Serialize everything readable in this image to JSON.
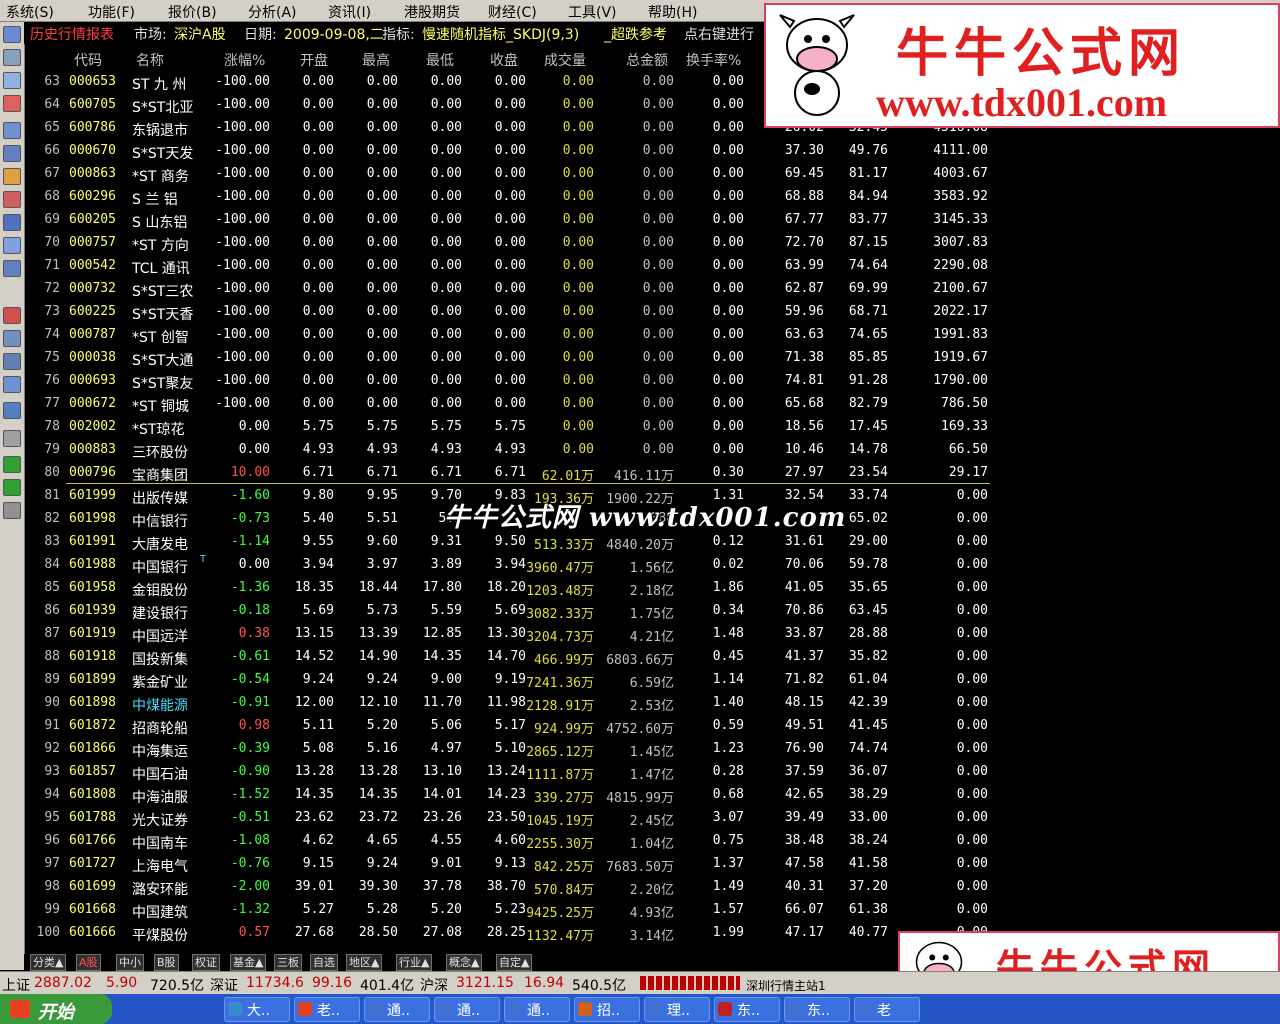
{
  "menu": [
    "系统(S)",
    "功能(F)",
    "报价(B)",
    "分析(A)",
    "资讯(I)",
    "港股期货",
    "财经(C)",
    "工具(V)",
    "帮助(H)"
  ],
  "infobar": {
    "title": "历史行情报表",
    "market_label": "市场:",
    "market": "深沪A股",
    "date_label": "日期:",
    "date": "2009-09-08,二",
    "indicator_label": "指标:",
    "indicator": "慢速随机指标_SKDJ(9,3)",
    "extra1": "_超跌参考",
    "extra2": "点右键进行"
  },
  "columns": [
    "代码",
    "名称",
    "涨幅%",
    "开盘",
    "最高",
    "最低",
    "收盘",
    "成交量",
    "总金额",
    "换手率%"
  ],
  "rows": [
    {
      "no": "63",
      "code": "000653",
      "name": "ST 九 州",
      "chg": "-100.00",
      "open": "0.00",
      "high": "0.00",
      "low": "0.00",
      "close": "0.00",
      "vol": "0.00",
      "amt": "0.00",
      "turn": "0.00",
      "k": "",
      "d": "",
      "x": ""
    },
    {
      "no": "64",
      "code": "600705",
      "name": "S*ST北亚",
      "chg": "-100.00",
      "open": "0.00",
      "high": "0.00",
      "low": "0.00",
      "close": "0.00",
      "vol": "0.00",
      "amt": "0.00",
      "turn": "0.00",
      "k": "",
      "d": "",
      "x": ""
    },
    {
      "no": "65",
      "code": "600786",
      "name": "东锅退市",
      "chg": "-100.00",
      "open": "0.00",
      "high": "0.00",
      "low": "0.00",
      "close": "0.00",
      "vol": "0.00",
      "amt": "0.00",
      "turn": "0.00",
      "k": "",
      "d": "",
      "x": ""
    },
    {
      "no": "66",
      "code": "000670",
      "name": "S*ST天发",
      "chg": "-100.00",
      "open": "0.00",
      "high": "0.00",
      "low": "0.00",
      "close": "0.00",
      "vol": "0.00",
      "amt": "0.00",
      "turn": "0.00",
      "k": "37.30",
      "d": "49.76",
      "x": "4111.00"
    },
    {
      "no": "67",
      "code": "000863",
      "name": "*ST 商务",
      "chg": "-100.00",
      "open": "0.00",
      "high": "0.00",
      "low": "0.00",
      "close": "0.00",
      "vol": "0.00",
      "amt": "0.00",
      "turn": "0.00",
      "k": "69.45",
      "d": "81.17",
      "x": "4003.67"
    },
    {
      "no": "68",
      "code": "600296",
      "name": "S 兰 铝",
      "chg": "-100.00",
      "open": "0.00",
      "high": "0.00",
      "low": "0.00",
      "close": "0.00",
      "vol": "0.00",
      "amt": "0.00",
      "turn": "0.00",
      "k": "68.88",
      "d": "84.94",
      "x": "3583.92"
    },
    {
      "no": "69",
      "code": "600205",
      "name": "S 山东铝",
      "chg": "-100.00",
      "open": "0.00",
      "high": "0.00",
      "low": "0.00",
      "close": "0.00",
      "vol": "0.00",
      "amt": "0.00",
      "turn": "0.00",
      "k": "67.77",
      "d": "83.77",
      "x": "3145.33"
    },
    {
      "no": "70",
      "code": "000757",
      "name": "*ST 方向",
      "chg": "-100.00",
      "open": "0.00",
      "high": "0.00",
      "low": "0.00",
      "close": "0.00",
      "vol": "0.00",
      "amt": "0.00",
      "turn": "0.00",
      "k": "72.70",
      "d": "87.15",
      "x": "3007.83"
    },
    {
      "no": "71",
      "code": "000542",
      "name": "TCL 通讯",
      "chg": "-100.00",
      "open": "0.00",
      "high": "0.00",
      "low": "0.00",
      "close": "0.00",
      "vol": "0.00",
      "amt": "0.00",
      "turn": "0.00",
      "k": "63.99",
      "d": "74.64",
      "x": "2290.08"
    },
    {
      "no": "72",
      "code": "000732",
      "name": "S*ST三农",
      "chg": "-100.00",
      "open": "0.00",
      "high": "0.00",
      "low": "0.00",
      "close": "0.00",
      "vol": "0.00",
      "amt": "0.00",
      "turn": "0.00",
      "k": "62.87",
      "d": "69.99",
      "x": "2100.67"
    },
    {
      "no": "73",
      "code": "600225",
      "name": "S*ST天香",
      "chg": "-100.00",
      "open": "0.00",
      "high": "0.00",
      "low": "0.00",
      "close": "0.00",
      "vol": "0.00",
      "amt": "0.00",
      "turn": "0.00",
      "k": "59.96",
      "d": "68.71",
      "x": "2022.17"
    },
    {
      "no": "74",
      "code": "000787",
      "name": "*ST 创智",
      "chg": "-100.00",
      "open": "0.00",
      "high": "0.00",
      "low": "0.00",
      "close": "0.00",
      "vol": "0.00",
      "amt": "0.00",
      "turn": "0.00",
      "k": "63.63",
      "d": "74.65",
      "x": "1991.83"
    },
    {
      "no": "75",
      "code": "000038",
      "name": "S*ST大通",
      "chg": "-100.00",
      "open": "0.00",
      "high": "0.00",
      "low": "0.00",
      "close": "0.00",
      "vol": "0.00",
      "amt": "0.00",
      "turn": "0.00",
      "k": "71.38",
      "d": "85.85",
      "x": "1919.67"
    },
    {
      "no": "76",
      "code": "000693",
      "name": "S*ST聚友",
      "chg": "-100.00",
      "open": "0.00",
      "high": "0.00",
      "low": "0.00",
      "close": "0.00",
      "vol": "0.00",
      "amt": "0.00",
      "turn": "0.00",
      "k": "74.81",
      "d": "91.28",
      "x": "1790.00"
    },
    {
      "no": "77",
      "code": "000672",
      "name": "*ST 铜城",
      "chg": "-100.00",
      "open": "0.00",
      "high": "0.00",
      "low": "0.00",
      "close": "0.00",
      "vol": "0.00",
      "amt": "0.00",
      "turn": "0.00",
      "k": "65.68",
      "d": "82.79",
      "x": "786.50"
    },
    {
      "no": "78",
      "code": "002002",
      "name": "*ST琼花",
      "chg": "0.00",
      "open": "5.75",
      "high": "5.75",
      "low": "5.75",
      "close": "5.75",
      "vol": "0.00",
      "amt": "0.00",
      "turn": "0.00",
      "k": "18.56",
      "d": "17.45",
      "x": "169.33"
    },
    {
      "no": "79",
      "code": "000883",
      "name": "三环股份",
      "chg": "0.00",
      "open": "4.93",
      "high": "4.93",
      "low": "4.93",
      "close": "4.93",
      "vol": "0.00",
      "amt": "0.00",
      "turn": "0.00",
      "k": "10.46",
      "d": "14.78",
      "x": "66.50"
    },
    {
      "no": "80",
      "code": "000796",
      "name": "宝商集团",
      "chg": "10.00",
      "open": "6.71",
      "high": "6.71",
      "low": "6.71",
      "close": "6.71",
      "vol": "62.01万",
      "amt": "416.11万",
      "turn": "0.30",
      "k": "27.97",
      "d": "23.54",
      "x": "29.17"
    },
    {
      "no": "81",
      "code": "601999",
      "name": "出版传媒",
      "chg": "-1.60",
      "open": "9.80",
      "high": "9.95",
      "low": "9.70",
      "close": "9.83",
      "vol": "193.36万",
      "amt": "1900.22万",
      "turn": "1.31",
      "k": "32.54",
      "d": "33.74",
      "x": "0.00"
    },
    {
      "no": "82",
      "code": "601998",
      "name": "中信银行",
      "chg": "-0.73",
      "open": "5.40",
      "high": "5.51",
      "low": "5.3",
      "close": "",
      "vol": "",
      "amt": "888",
      "turn": "",
      "k": "",
      "d": "65.02",
      "x": "0.00"
    },
    {
      "no": "83",
      "code": "601991",
      "name": "大唐发电",
      "chg": "-1.14",
      "open": "9.55",
      "high": "9.60",
      "low": "9.31",
      "close": "9.50",
      "vol": "513.33万",
      "amt": "4840.20万",
      "turn": "0.12",
      "k": "31.61",
      "d": "29.00",
      "x": "0.00"
    },
    {
      "no": "84",
      "code": "601988",
      "name": "中国银行",
      "chg": "0.00",
      "open": "3.94",
      "high": "3.97",
      "low": "3.89",
      "close": "3.94",
      "vol": "3960.47万",
      "amt": "1.56亿",
      "turn": "0.02",
      "k": "70.06",
      "d": "59.78",
      "x": "0.00"
    },
    {
      "no": "85",
      "code": "601958",
      "name": "金钼股份",
      "chg": "-1.36",
      "open": "18.35",
      "high": "18.44",
      "low": "17.80",
      "close": "18.20",
      "vol": "1203.48万",
      "amt": "2.18亿",
      "turn": "1.86",
      "k": "41.05",
      "d": "35.65",
      "x": "0.00"
    },
    {
      "no": "86",
      "code": "601939",
      "name": "建设银行",
      "chg": "-0.18",
      "open": "5.69",
      "high": "5.73",
      "low": "5.59",
      "close": "5.69",
      "vol": "3082.33万",
      "amt": "1.75亿",
      "turn": "0.34",
      "k": "70.86",
      "d": "63.45",
      "x": "0.00"
    },
    {
      "no": "87",
      "code": "601919",
      "name": "中国远洋",
      "chg": "0.38",
      "open": "13.15",
      "high": "13.39",
      "low": "12.85",
      "close": "13.30",
      "vol": "3204.73万",
      "amt": "4.21亿",
      "turn": "1.48",
      "k": "33.87",
      "d": "28.88",
      "x": "0.00"
    },
    {
      "no": "88",
      "code": "601918",
      "name": "国投新集",
      "chg": "-0.61",
      "open": "14.52",
      "high": "14.90",
      "low": "14.35",
      "close": "14.70",
      "vol": "466.99万",
      "amt": "6803.66万",
      "turn": "0.45",
      "k": "41.37",
      "d": "35.82",
      "x": "0.00"
    },
    {
      "no": "89",
      "code": "601899",
      "name": "紫金矿业",
      "chg": "-0.54",
      "open": "9.24",
      "high": "9.24",
      "low": "9.00",
      "close": "9.19",
      "vol": "7241.36万",
      "amt": "6.59亿",
      "turn": "1.14",
      "k": "71.82",
      "d": "61.04",
      "x": "0.00"
    },
    {
      "no": "90",
      "code": "601898",
      "name": "中煤能源",
      "chg": "-0.91",
      "open": "12.00",
      "high": "12.10",
      "low": "11.70",
      "close": "11.98",
      "vol": "2128.91万",
      "amt": "2.53亿",
      "turn": "1.40",
      "k": "48.15",
      "d": "42.39",
      "x": "0.00"
    },
    {
      "no": "91",
      "code": "601872",
      "name": "招商轮船",
      "chg": "0.98",
      "open": "5.11",
      "high": "5.20",
      "low": "5.06",
      "close": "5.17",
      "vol": "924.99万",
      "amt": "4752.60万",
      "turn": "0.59",
      "k": "49.51",
      "d": "41.45",
      "x": "0.00"
    },
    {
      "no": "92",
      "code": "601866",
      "name": "中海集运",
      "chg": "-0.39",
      "open": "5.08",
      "high": "5.16",
      "low": "4.97",
      "close": "5.10",
      "vol": "2865.12万",
      "amt": "1.45亿",
      "turn": "1.23",
      "k": "76.90",
      "d": "74.74",
      "x": "0.00"
    },
    {
      "no": "93",
      "code": "601857",
      "name": "中国石油",
      "chg": "-0.90",
      "open": "13.28",
      "high": "13.28",
      "low": "13.10",
      "close": "13.24",
      "vol": "1111.87万",
      "amt": "1.47亿",
      "turn": "0.28",
      "k": "37.59",
      "d": "36.07",
      "x": "0.00"
    },
    {
      "no": "94",
      "code": "601808",
      "name": "中海油服",
      "chg": "-1.52",
      "open": "14.35",
      "high": "14.35",
      "low": "14.01",
      "close": "14.23",
      "vol": "339.27万",
      "amt": "4815.99万",
      "turn": "0.68",
      "k": "42.65",
      "d": "38.29",
      "x": "0.00"
    },
    {
      "no": "95",
      "code": "601788",
      "name": "光大证券",
      "chg": "-0.51",
      "open": "23.62",
      "high": "23.72",
      "low": "23.26",
      "close": "23.50",
      "vol": "1045.19万",
      "amt": "2.45亿",
      "turn": "3.07",
      "k": "39.49",
      "d": "33.00",
      "x": "0.00"
    },
    {
      "no": "96",
      "code": "601766",
      "name": "中国南车",
      "chg": "-1.08",
      "open": "4.62",
      "high": "4.65",
      "low": "4.55",
      "close": "4.60",
      "vol": "2255.30万",
      "amt": "1.04亿",
      "turn": "0.75",
      "k": "38.48",
      "d": "38.24",
      "x": "0.00"
    },
    {
      "no": "97",
      "code": "601727",
      "name": "上海电气",
      "chg": "-0.76",
      "open": "9.15",
      "high": "9.24",
      "low": "9.01",
      "close": "9.13",
      "vol": "842.25万",
      "amt": "7683.50万",
      "turn": "1.37",
      "k": "47.58",
      "d": "41.58",
      "x": "0.00"
    },
    {
      "no": "98",
      "code": "601699",
      "name": "潞安环能",
      "chg": "-2.00",
      "open": "39.01",
      "high": "39.30",
      "low": "37.78",
      "close": "38.70",
      "vol": "570.84万",
      "amt": "2.20亿",
      "turn": "1.49",
      "k": "40.31",
      "d": "37.20",
      "x": "0.00"
    },
    {
      "no": "99",
      "code": "601668",
      "name": "中国建筑",
      "chg": "-1.32",
      "open": "5.27",
      "high": "5.28",
      "low": "5.20",
      "close": "5.23",
      "vol": "9425.25万",
      "amt": "4.93亿",
      "turn": "1.57",
      "k": "66.07",
      "d": "61.38",
      "x": "0.00"
    },
    {
      "no": "100",
      "code": "601666",
      "name": "平煤股份",
      "chg": "0.57",
      "open": "27.68",
      "high": "28.50",
      "low": "27.08",
      "close": "28.25",
      "vol": "1132.47万",
      "amt": "3.14亿",
      "turn": "1.99",
      "k": "47.17",
      "d": "40.77",
      "x": "0.00"
    }
  ],
  "partial_row_k65": "26.02",
  "partial_row_d65": "32.45",
  "partial_row_x65": "4516.08",
  "row84_mark": "T",
  "watermark_mid": "牛牛公式网 www.tdx001.com",
  "ad": {
    "title": "牛牛公式网",
    "url": "www.tdx001.com"
  },
  "tabs": [
    "分类▲",
    "A股",
    "中小",
    "B股",
    "权证",
    "基金▲",
    "三板",
    "自选",
    "地区▲",
    "行业▲",
    "概念▲",
    "自定▲"
  ],
  "status": {
    "sh_label": "上证",
    "sh_index": "2887.02",
    "sh_chg": "5.90",
    "sh_amt": "720.5亿",
    "sz_label": "深证",
    "sz_index": "11734.6",
    "sz_chg": "99.16",
    "sz_amt": "401.4亿",
    "hs_label": "沪深",
    "hs_index": "3121.15",
    "hs_chg": "16.94",
    "hs_amt": "540.5亿",
    "station": "深圳行情主站1"
  },
  "taskbar": {
    "start": "开始",
    "apps": [
      "大..",
      "老..",
      "通..",
      "通..",
      "通..",
      "招..",
      "理..",
      "东..",
      "东..",
      "老"
    ]
  },
  "colors": {
    "up": "#ff5050",
    "down": "#40ff40",
    "code": "#ffff66",
    "title": "#ff4040"
  }
}
